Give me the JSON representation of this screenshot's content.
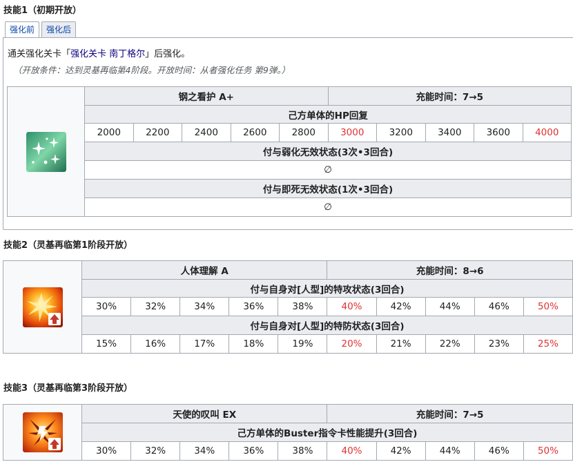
{
  "skill1": {
    "heading": "技能1（初期开放）",
    "tabs": [
      "强化前",
      "强化后"
    ],
    "unlock_prefix": "通关强化关卡「",
    "unlock_link": "强化关卡 南丁格尔",
    "unlock_suffix": "」后强化。",
    "condition": "（开放条件：达到灵基再临第4阶段。开放时间：从者强化任务 第9弹。）",
    "icon": "heal-sparkle-icon",
    "name": "钢之看护 A+",
    "cooldown": "充能时间：7→5",
    "effects": [
      {
        "title": "己方单体的HP回复",
        "values": [
          "2000",
          "2200",
          "2400",
          "2600",
          "2800",
          "3000",
          "3200",
          "3400",
          "3600",
          "4000"
        ],
        "highlight": [
          5,
          9
        ]
      },
      {
        "title": "付与弱化无效状态(3次•3回合)",
        "single": "∅"
      },
      {
        "title": "付与即死无效状态(1次•3回合)",
        "single": "∅"
      }
    ]
  },
  "skill2": {
    "heading": "技能2（灵基再临第1阶段开放）",
    "icon": "attack-up-icon",
    "name": "人体理解 A",
    "cooldown": "充能时间：8→6",
    "effects": [
      {
        "title": "付与自身对[人型]的特攻状态(3回合)",
        "values": [
          "30%",
          "32%",
          "34%",
          "36%",
          "38%",
          "40%",
          "42%",
          "44%",
          "46%",
          "50%"
        ],
        "highlight": [
          5,
          9
        ]
      },
      {
        "title": "付与自身对[人型]的特防状态(3回合)",
        "values": [
          "15%",
          "16%",
          "17%",
          "18%",
          "19%",
          "20%",
          "21%",
          "22%",
          "23%",
          "25%"
        ],
        "highlight": [
          5,
          9
        ]
      }
    ]
  },
  "skill3": {
    "heading": "技能3（灵基再临第3阶段开放）",
    "icon": "buster-up-icon",
    "name": "天使的叹叫 EX",
    "cooldown": "充能时间：7→5",
    "effects": [
      {
        "title": "己方单体的Buster指令卡性能提升(3回合)",
        "values": [
          "30%",
          "32%",
          "34%",
          "36%",
          "38%",
          "40%",
          "42%",
          "44%",
          "46%",
          "50%"
        ],
        "highlight": [
          5,
          9
        ]
      }
    ]
  },
  "colors": {
    "highlight": "#e03131",
    "header_bg": "#eaecf0",
    "border": "#a2a9b1",
    "link": "#0b0080"
  }
}
